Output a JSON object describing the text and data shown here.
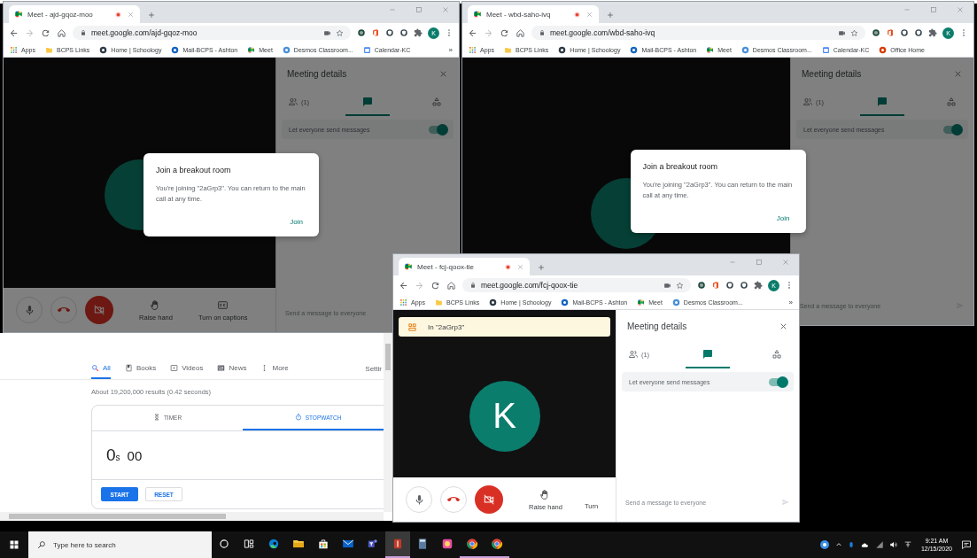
{
  "windows": [
    {
      "tab_title": "Meet - ajd-gqoz-moo",
      "url": "meet.google.com/ajd-gqoz-moo",
      "profile_initial": "K",
      "dimmed": true,
      "bookmarks": [
        {
          "kind": "apps",
          "label": "Apps"
        },
        {
          "kind": "folder",
          "label": "BCPS Links"
        },
        {
          "kind": "site",
          "label": "Home | Schoology",
          "color": "#2f3b45"
        },
        {
          "kind": "site",
          "label": "Mail-BCPS - Ashton",
          "color": "#1565c0"
        },
        {
          "kind": "meet",
          "label": "Meet"
        },
        {
          "kind": "site",
          "label": "Desmos Classroom...",
          "color": "#4a8fd6"
        },
        {
          "kind": "calendar",
          "label": "Calendar-KC"
        }
      ],
      "bookmarks_overflow": "»",
      "controls": [
        {
          "kind": "mic"
        },
        {
          "kind": "hangup"
        },
        {
          "kind": "camera-off"
        },
        {
          "kind": "raise-hand",
          "label": "Raise hand"
        },
        {
          "kind": "captions",
          "label": "Turn on captions"
        }
      ],
      "panel": {
        "title": "Meeting details",
        "tabs": [
          {
            "kind": "people",
            "label": "(1)",
            "selected": false
          },
          {
            "kind": "chat",
            "selected": true
          },
          {
            "kind": "activities",
            "selected": false
          }
        ],
        "setting": {
          "label": "Let everyone send messages",
          "on": true
        },
        "message_placeholder": "Send a message to everyone"
      },
      "dialog": {
        "title": "Join a breakout room",
        "body": "You're joining \"2aGrp3\". You can return to the main call at any time.",
        "action": "Join"
      }
    },
    {
      "tab_title": "Meet - wbd-saho-ivq",
      "url": "meet.google.com/wbd-saho-ivq",
      "profile_initial": "K",
      "dimmed": true,
      "bookmarks": [
        {
          "kind": "apps",
          "label": "Apps"
        },
        {
          "kind": "folder",
          "label": "BCPS Links"
        },
        {
          "kind": "site",
          "label": "Home | Schoology",
          "color": "#2f3b45"
        },
        {
          "kind": "site",
          "label": "Mail-BCPS - Ashton",
          "color": "#1565c0"
        },
        {
          "kind": "meet",
          "label": "Meet"
        },
        {
          "kind": "site",
          "label": "Desmos Classroom...",
          "color": "#4a8fd6"
        },
        {
          "kind": "calendar",
          "label": "Calendar-KC"
        },
        {
          "kind": "site",
          "label": "Office Home",
          "color": "#d83b01"
        }
      ],
      "panel": {
        "title": "Meeting details",
        "tabs": [
          {
            "kind": "people",
            "label": "(1)",
            "selected": false
          },
          {
            "kind": "chat",
            "selected": true
          },
          {
            "kind": "activities",
            "selected": false
          }
        ],
        "setting": {
          "label": "Let everyone send messages",
          "on": true
        },
        "message_placeholder": "Send a message to everyone"
      },
      "dialog": {
        "title": "Join a breakout room",
        "body": "You're joining \"2aGrp3\". You can return to the main call at any time.",
        "action": "Join"
      }
    },
    {
      "tab_title": "Meet - fcj-qoox-tie",
      "url": "meet.google.com/fcj-qoox-tie",
      "profile_initial": "K",
      "dimmed": false,
      "bookmarks": [
        {
          "kind": "apps",
          "label": "Apps"
        },
        {
          "kind": "folder",
          "label": "BCPS Links"
        },
        {
          "kind": "site",
          "label": "Home | Schoology",
          "color": "#2f3b45"
        },
        {
          "kind": "site",
          "label": "Mail-BCPS - Ashton",
          "color": "#1565c0"
        },
        {
          "kind": "meet",
          "label": "Meet"
        },
        {
          "kind": "site",
          "label": "Desmos Classroom...",
          "color": "#4a8fd6"
        }
      ],
      "bookmarks_overflow": "»",
      "banner": "In \"2aGrp3\"",
      "avatar": "K",
      "controls": [
        {
          "kind": "mic"
        },
        {
          "kind": "hangup"
        },
        {
          "kind": "camera-off"
        },
        {
          "kind": "raise-hand",
          "label": "Raise hand"
        },
        {
          "kind": "text",
          "label": "Turn"
        }
      ],
      "panel": {
        "title": "Meeting details",
        "tabs": [
          {
            "kind": "people",
            "label": "(1)",
            "selected": false
          },
          {
            "kind": "chat",
            "selected": true
          },
          {
            "kind": "activities",
            "selected": false
          }
        ],
        "setting": {
          "label": "Let everyone send messages",
          "on": true
        },
        "message_placeholder": "Send a message to everyone"
      }
    }
  ],
  "search_window": {
    "tabs": [
      {
        "kind": "all",
        "label": "All",
        "selected": true
      },
      {
        "kind": "books",
        "label": "Books",
        "selected": false
      },
      {
        "kind": "videos",
        "label": "Videos",
        "selected": false
      },
      {
        "kind": "news",
        "label": "News",
        "selected": false
      },
      {
        "kind": "more",
        "label": "More",
        "selected": false
      }
    ],
    "settings_label": "Settir",
    "result_stats": "About 19,200,000 results (0.42 seconds)",
    "widget": {
      "tabs": [
        {
          "kind": "timer",
          "label": "TIMER",
          "selected": false
        },
        {
          "kind": "stopwatch",
          "label": "STOPWATCH",
          "selected": true
        }
      ],
      "seconds": "0",
      "seconds_unit": "s",
      "hundredths": "00",
      "buttons": [
        {
          "kind": "primary",
          "label": "START"
        },
        {
          "kind": "secondary",
          "label": "RESET"
        }
      ]
    }
  },
  "taskbar": {
    "search_placeholder": "Type here to search",
    "apps": [
      {
        "kind": "cortana",
        "selected": false,
        "running": false
      },
      {
        "kind": "task-view",
        "selected": false,
        "running": false
      },
      {
        "kind": "edge",
        "selected": false,
        "running": false
      },
      {
        "kind": "explorer",
        "selected": false,
        "running": false
      },
      {
        "kind": "store",
        "selected": false,
        "running": false
      },
      {
        "kind": "mail",
        "selected": false,
        "running": false
      },
      {
        "kind": "teams",
        "selected": false,
        "running": false
      },
      {
        "kind": "app",
        "selected": true,
        "running": true
      },
      {
        "kind": "calculator",
        "selected": false,
        "running": false
      },
      {
        "kind": "photos",
        "selected": false,
        "running": false
      },
      {
        "kind": "chrome",
        "selected": false,
        "running": true
      },
      {
        "kind": "chrome",
        "selected": false,
        "running": true
      }
    ],
    "time": "9:21 AM",
    "date": "12/15/2020"
  }
}
